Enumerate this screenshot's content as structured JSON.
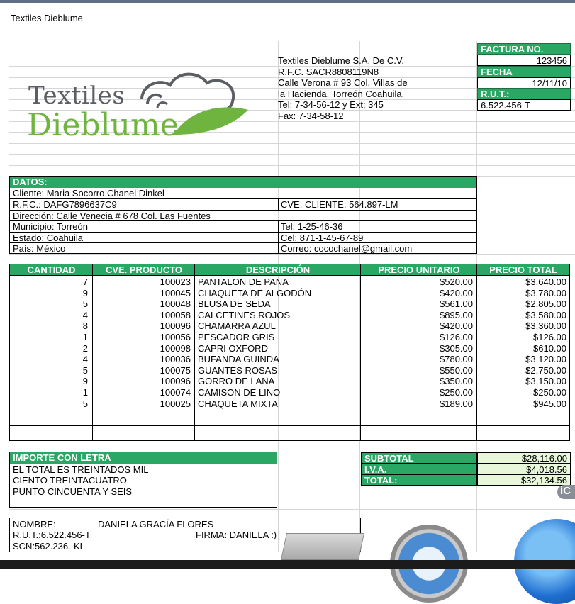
{
  "window_title": "Textiles Dieblume",
  "company": {
    "logo_line1": "Textiles",
    "logo_line2": "Dieblume",
    "lines": [
      "Textiles Dieblume S.A. De C.V.",
      "R.F.C. SACR8808119N8",
      "Calle Verona # 93 Col. Villas de",
      "la Hacienda. Torreón Coahuila.",
      "Tel: 7-34-56-12 y Ext: 345",
      "Fax: 7-34-58-12"
    ]
  },
  "invoice": {
    "factura_label": "FACTURA NO.",
    "factura_value": "123456",
    "fecha_label": "FECHA",
    "fecha_value": "12/11/10",
    "rut_label": "R.U.T.:",
    "rut_value": "6.522.456-T"
  },
  "datos": {
    "header": "DATOS:",
    "cliente": "Cliente: Maria Socorro Chanel Dinkel",
    "rfc": "R.F.C.: DAFG7896637C9",
    "cve_cliente": "CVE. CLIENTE: 564.897-LM",
    "direccion": "Dirección: Calle Venecia # 678 Col. Las Fuentes",
    "municipio": "Municipio: Torreón",
    "tel": "Tel: 1-25-46-36",
    "estado": "Estado: Coahuila",
    "cel": "Cel: 871-1-45-67-89",
    "pais": "País: México",
    "correo": "Correo: cocochanel@gmail.com"
  },
  "items_table": {
    "headers": [
      "CANTIDAD",
      "CVE. PRODUCTO",
      "DESCRIPCIÓN",
      "PRECIO UNITARIO",
      "PRECIO TOTAL"
    ],
    "rows": [
      [
        "7",
        "100023",
        "PANTALON DE PANA",
        "$520.00",
        "$3,640.00"
      ],
      [
        "9",
        "100045",
        "CHAQUETA DE ALGODÓN",
        "$420.00",
        "$3,780.00"
      ],
      [
        "5",
        "100048",
        "BLUSA DE SEDA",
        "$561.00",
        "$2,805.00"
      ],
      [
        "4",
        "100058",
        "CALCETINES ROJOS",
        "$895.00",
        "$3,580.00"
      ],
      [
        "8",
        "100096",
        "CHAMARRA AZUL",
        "$420.00",
        "$3,360.00"
      ],
      [
        "1",
        "100056",
        "PESCADOR GRIS",
        "$126.00",
        "$126.00"
      ],
      [
        "2",
        "100098",
        "CAPRI OXFORD",
        "$305.00",
        "$610.00"
      ],
      [
        "4",
        "100036",
        "BUFANDA GUINDA",
        "$780.00",
        "$3,120.00"
      ],
      [
        "5",
        "100075",
        "GUANTES ROSAS",
        "$550.00",
        "$2,750.00"
      ],
      [
        "9",
        "100096",
        "GORRO DE LANA",
        "$350.00",
        "$3,150.00"
      ],
      [
        "1",
        "100074",
        "CAMISON DE LINO",
        "$250.00",
        "$250.00"
      ],
      [
        "5",
        "100025",
        "CHAQUETA MIXTA",
        "$189.00",
        "$945.00"
      ]
    ]
  },
  "importe": {
    "header": "IMPORTE CON LETRA",
    "lines": [
      "EL TOTAL ES TREINTADOS MIL",
      "CIENTO TREINTACUATRO",
      "PUNTO CINCUENTA Y SEIS"
    ]
  },
  "totals": {
    "subtotal_label": "SUBTOTAL",
    "subtotal_value": "$28,116.00",
    "iva_label": "I.V.A.",
    "iva_value": "$4,018.56",
    "total_label": "TOTAL:",
    "total_value": "$32,134.56"
  },
  "signature": {
    "nombre_label": "NOMBRE:",
    "nombre_value": "DANIELA GRACÍA FLORES",
    "rut": "R.U.T.:6.522.456-T",
    "firma": "FIRMA: DANIELA :)",
    "scn": "SCN:562.236.-KL"
  },
  "dock_fragment": "iC",
  "colors": {
    "header_green": "#2aa764",
    "logo_green": "#6fb43f",
    "logo_gray": "#5b5e63",
    "totals_bg": "#e8f6d9"
  }
}
